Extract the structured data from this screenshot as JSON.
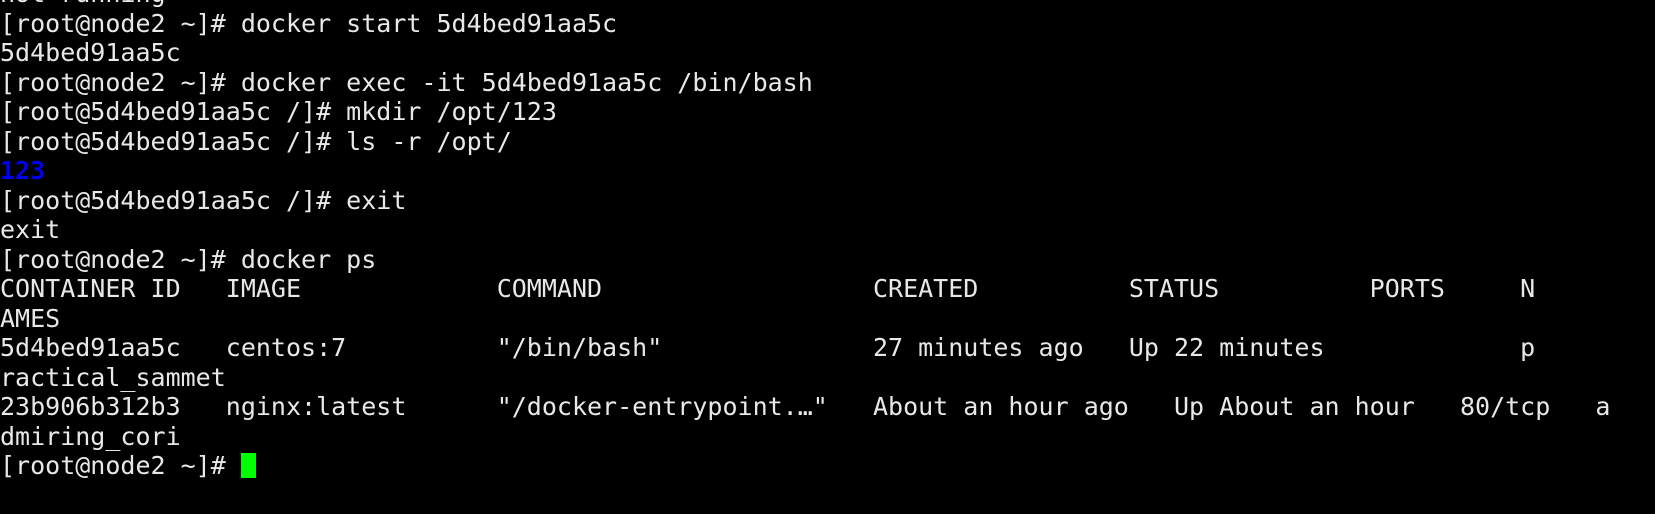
{
  "terminal": {
    "background_color": "#000000",
    "foreground_color": "#e8e8e8",
    "dir_color": "#0000ee",
    "cursor_color": "#00ff00",
    "columns": 107,
    "rows": 17
  },
  "lines": [
    {
      "id": "line-0-clipped-not-running",
      "text": "not running"
    },
    {
      "id": "line-1-prompt-docker-start",
      "text": "[root@node2 ~]# docker start 5d4bed91aa5c"
    },
    {
      "id": "line-2-start-output",
      "text": "5d4bed91aa5c"
    },
    {
      "id": "line-3-prompt-docker-exec",
      "text": "[root@node2 ~]# docker exec -it 5d4bed91aa5c /bin/bash"
    },
    {
      "id": "line-4-prompt-mkdir",
      "text": "[root@5d4bed91aa5c /]# mkdir /opt/123"
    },
    {
      "id": "line-5-prompt-ls",
      "text": "[root@5d4bed91aa5c /]# ls -r /opt/"
    },
    {
      "id": "line-6-ls-output-dir",
      "text": "123"
    },
    {
      "id": "line-7-prompt-exit",
      "text": "[root@5d4bed91aa5c /]# exit"
    },
    {
      "id": "line-8-exit-output",
      "text": "exit"
    },
    {
      "id": "line-9-prompt-docker-ps",
      "text": "[root@node2 ~]# docker ps"
    },
    {
      "id": "line-10-ps-header",
      "text": "CONTAINER ID   IMAGE             COMMAND                  CREATED          STATUS          PORTS     N"
    },
    {
      "id": "line-11-ps-header-wrap",
      "text": "AMES"
    },
    {
      "id": "line-12-ps-row-1",
      "text": "5d4bed91aa5c   centos:7          \"/bin/bash\"              27 minutes ago   Up 22 minutes             p"
    },
    {
      "id": "line-13-ps-row-1-wrap",
      "text": "ractical_sammet"
    },
    {
      "id": "line-14-ps-row-2",
      "text": "23b906b312b3   nginx:latest      \"/docker-entrypoint.…\"   About an hour ago   Up About an hour   80/tcp   a"
    },
    {
      "id": "line-15-ps-row-2-wrap",
      "text": "dmiring_cori"
    },
    {
      "id": "line-16-final-prompt",
      "text": "[root@node2 ~]# "
    }
  ],
  "ps_table": {
    "columns": [
      "CONTAINER ID",
      "IMAGE",
      "COMMAND",
      "CREATED",
      "STATUS",
      "PORTS",
      "NAMES"
    ],
    "rows": [
      {
        "container_id": "5d4bed91aa5c",
        "image": "centos:7",
        "command": "\"/bin/bash\"",
        "created": "27 minutes ago",
        "status": "Up 22 minutes",
        "ports": "",
        "names": "practical_sammet"
      },
      {
        "container_id": "23b906b312b3",
        "image": "nginx:latest",
        "command": "\"/docker-entrypoint.…\"",
        "created": "About an hour ago",
        "status": "Up About an hour",
        "ports": "80/tcp",
        "names": "admiring_cori"
      }
    ]
  },
  "prompts": {
    "host_prompt": "[root@node2 ~]#",
    "container_prompt": "[root@5d4bed91aa5c /]#"
  },
  "commands": [
    "docker start 5d4bed91aa5c",
    "docker exec -it 5d4bed91aa5c /bin/bash",
    "mkdir /opt/123",
    "ls -r /opt/",
    "exit",
    "docker ps"
  ]
}
